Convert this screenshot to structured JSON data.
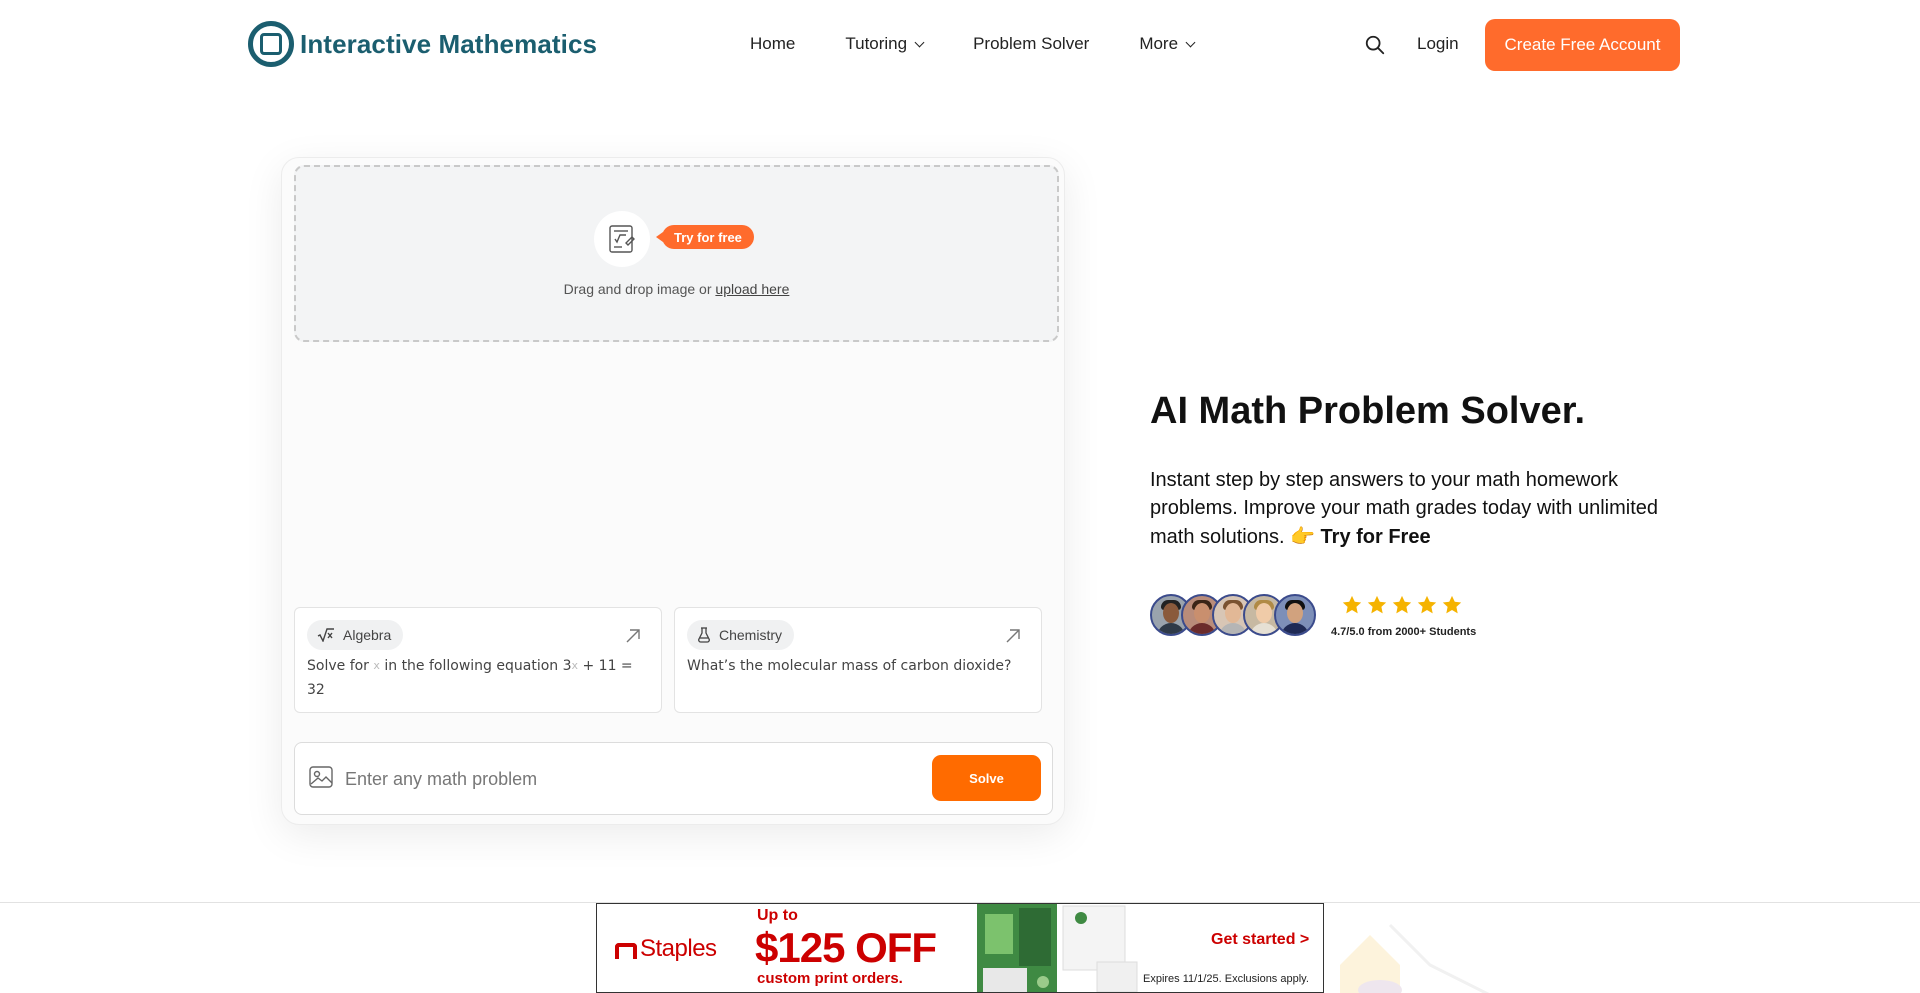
{
  "header": {
    "logo_text": "Interactive Mathematics",
    "nav": {
      "home": "Home",
      "tutoring": "Tutoring",
      "problem_solver": "Problem Solver",
      "more": "More"
    },
    "login": "Login",
    "cta": "Create Free Account"
  },
  "solver": {
    "try_badge": "Try for free",
    "drop_text": "Drag and drop image or ",
    "upload_link": "upload here",
    "examples": [
      {
        "tag": "Algebra",
        "text_a": "Solve for ",
        "var_a": "x",
        "text_b": " in the following equation 3",
        "var_b": "x",
        "text_c": " + 11 = 32"
      },
      {
        "tag": "Chemistry",
        "text": "What’s the molecular mass of carbon dioxide?"
      }
    ],
    "input_placeholder": "Enter any math problem",
    "solve_button": "Solve"
  },
  "hero": {
    "title": "AI Math Problem Solver.",
    "description": "Instant step by step answers to your math homework problems. Improve your math grades today with unlimited math solutions. ",
    "emoji": "👉",
    "try_link": "Try for Free",
    "rating_text": "4.7/5.0 from 2000+ Students",
    "rating_stars": 5
  },
  "ad": {
    "brand": "Staples",
    "upto": "Up to",
    "amount": "$125 OFF",
    "sub": "custom print orders.",
    "cta": "Get started >",
    "expires": "Expires 11/1/25. Exclusions apply."
  },
  "colors": {
    "brand_teal": "#1b5e6f",
    "accent_orange": "#ff6b2c",
    "star_gold": "#f5b301",
    "ad_red": "#cc0000"
  },
  "icons": {
    "search": "search-icon",
    "image_upload": "image-icon",
    "algebra": "sqrt-icon",
    "chemistry": "flask-icon",
    "arrow": "arrow-up-right-icon",
    "star": "star-icon"
  }
}
